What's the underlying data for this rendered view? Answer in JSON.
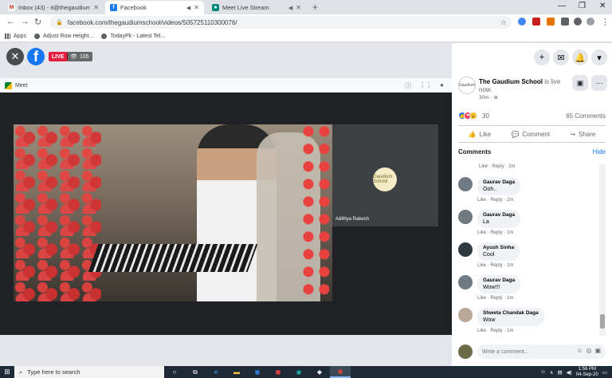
{
  "browser": {
    "tabs": [
      {
        "label": "Inbox (43) - it@thegaudium.com",
        "icon": "gmail-icon",
        "color": "#d93025"
      },
      {
        "label": "Facebook",
        "icon": "facebook-icon",
        "color": "#1877f2"
      },
      {
        "label": "Meet Live Stream",
        "icon": "meet-icon",
        "color": "#00897b"
      }
    ],
    "url": "facebook.com/thegaudiumschool/videos/505725110300076/",
    "bookmarks": [
      "Apps",
      "Adjust Row Height...",
      "TodayPk - Latest Tel..."
    ]
  },
  "viewer": {
    "live_label": "LIVE",
    "viewer_count": "105",
    "meet_label": "Meet",
    "side_participant": "Adithya Rakesh",
    "side_logo_text": "Gaudium School"
  },
  "post": {
    "page_name": "The Gaudium School",
    "status": "is live now.",
    "time": "30m",
    "avatar_text": "Gaudium",
    "reaction_count": "30",
    "comments_count": "65 Comments",
    "actions": {
      "like": "Like",
      "comment": "Comment",
      "share": "Share"
    }
  },
  "comments_section": {
    "title": "Comments",
    "hide_label": "Hide",
    "first_meta": "Like · Reply · 2m",
    "items": [
      {
        "author": "Gaurav Daga",
        "text": "Ooh..",
        "meta": "Like · Reply · 2m",
        "avatar_color": "#6f7a83"
      },
      {
        "author": "Gaurav Daga",
        "text": "La",
        "meta": "Like · Reply · 1m",
        "avatar_color": "#6f7a83"
      },
      {
        "author": "Ayush Sinha",
        "text": "Cool",
        "meta": "Like · Reply · 1m",
        "avatar_color": "#2f3a40"
      },
      {
        "author": "Gaurav Daga",
        "text": "Wow!!!",
        "meta": "Like · Reply · 1m",
        "avatar_color": "#6f7a83"
      },
      {
        "author": "Shweta Chandak Daga",
        "text": "Wow",
        "meta": "Like · Reply · 1m",
        "avatar_color": "#b9a895"
      }
    ],
    "write_placeholder": "Write a comment..."
  },
  "taskbar": {
    "search_placeholder": "Type here to search",
    "time": "1:56 PM",
    "date": "04-Sep-20"
  }
}
